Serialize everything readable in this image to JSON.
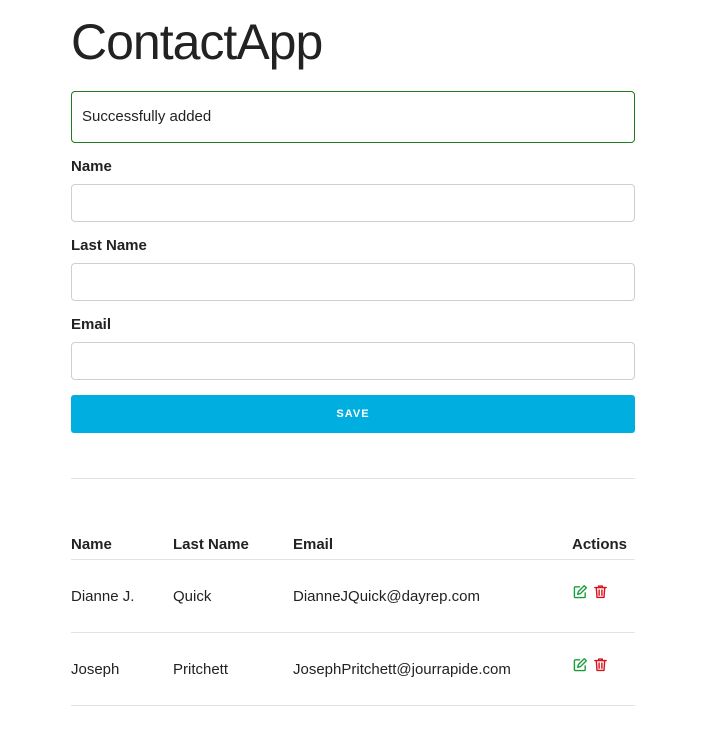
{
  "app": {
    "title": "ContactApp"
  },
  "alert": {
    "message": "Successfully added",
    "border_color": "#1e7b1e"
  },
  "form": {
    "name_label": "Name",
    "name_value": "",
    "last_name_label": "Last Name",
    "last_name_value": "",
    "email_label": "Email",
    "email_value": "",
    "save_label": "SAVE",
    "save_color": "#00afdf"
  },
  "table": {
    "headers": {
      "name": "Name",
      "last_name": "Last Name",
      "email": "Email",
      "actions": "Actions"
    },
    "rows": [
      {
        "name": "Dianne J.",
        "last_name": "Quick",
        "email": "DianneJQuick@dayrep.com",
        "edit_icon": "edit-icon",
        "delete_icon": "trash-icon"
      },
      {
        "name": "Joseph",
        "last_name": "Pritchett",
        "email": "JosephPritchett@jourrapide.com",
        "edit_icon": "edit-icon",
        "delete_icon": "trash-icon"
      }
    ]
  },
  "colors": {
    "edit_icon": "#1a9e3a",
    "delete_icon": "#d9101b"
  }
}
